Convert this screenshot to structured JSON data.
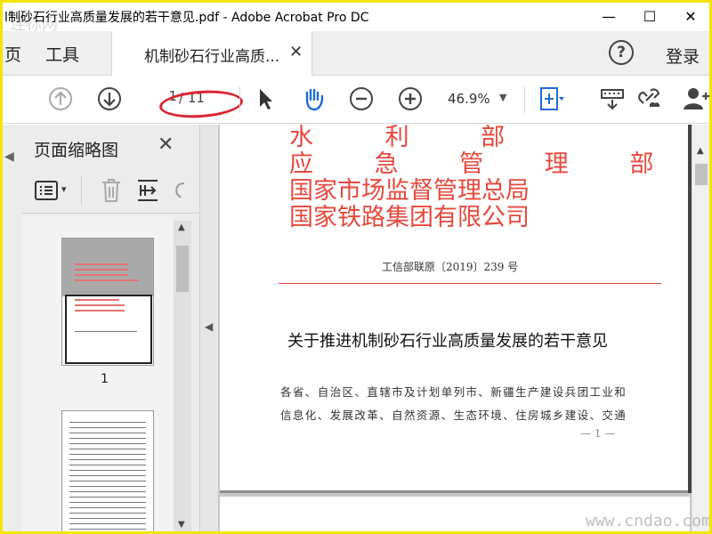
{
  "window": {
    "title": "l制砂石行业高质量发展的若干意见.pdf - Adobe Acrobat Pro DC",
    "watermark": "连标网",
    "minimize_glyph": "—",
    "maximize_glyph": "☐",
    "close_glyph": "✕"
  },
  "menubar": {
    "home_label": "页",
    "tools_label": "工具",
    "tab_label": "机制砂石行业高质...",
    "tab_close": "✕",
    "help_glyph": "?",
    "login_label": "登录"
  },
  "toolbar": {
    "page_current": "1",
    "page_total": "/ 11",
    "zoom": "46.9%",
    "zoom_caret": "▼",
    "annotation_color": "#d9262f"
  },
  "panel": {
    "title": "页面缩略图",
    "close_glyph": "✕",
    "options_caret": "▾",
    "thumb_page_label": "1",
    "thumb_arrow": "◀"
  },
  "document": {
    "red_header_lines": [
      "水 利 部",
      "应 急 管 理 部",
      "国家市场监督管理总局",
      "国家铁路集团有限公司"
    ],
    "doc_number": "工信部联原〔2019〕239 号",
    "heading": "关于推进机制砂石行业高质量发展的若干意见",
    "body_lines": [
      "各省、自治区、直辖市及计划单列市、新疆生产建设兵团工业和",
      "信息化、发展改革、自然资源、生态环境、住房城乡建设、交通"
    ],
    "page_footer": "— 1 —",
    "header_color": "#e7483c"
  },
  "watermark_br": "www.cndao.com"
}
